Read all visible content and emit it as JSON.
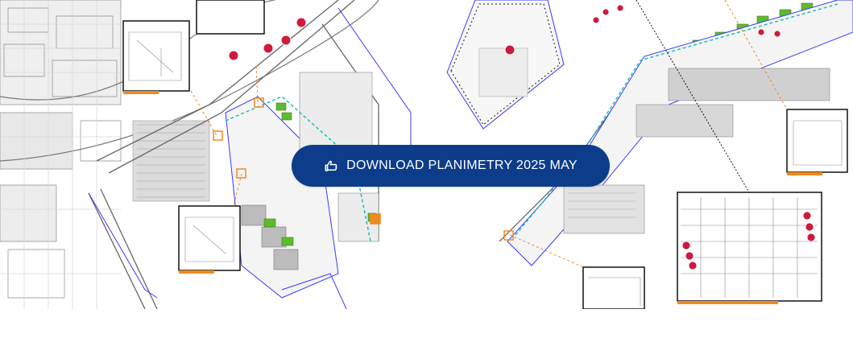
{
  "download_cta": {
    "label": "DOWNLOAD PLANIMETRY 2025 MAY",
    "icon": "hand-pointing-icon",
    "background": "#0d3d8a",
    "text_color": "#ffffff"
  },
  "map_colors": {
    "zone_outline": "#3a3aff",
    "zone_marker": "#cc1b3d",
    "plot_fill": "#5fba2f",
    "dashed_zone": "#1dbdb8",
    "callout_line": "#f08a1f",
    "building_fill": "#bcbcbc",
    "base_lines": "#8a8a8a"
  }
}
